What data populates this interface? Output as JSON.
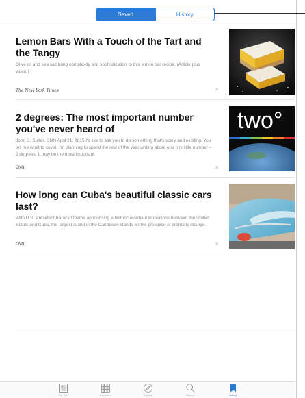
{
  "segments": {
    "saved": "Saved",
    "history": "History",
    "selected": "Saved"
  },
  "articles": [
    {
      "title": "Lemon Bars With a Touch of the Tart and the Tangy",
      "excerpt": "Olive oil and sea salt bring complexity and sophistication to this lemon bar recipe. (Article plus video.)",
      "source": "The New York Times",
      "age": "1h"
    },
    {
      "title": "2 degrees: The most important number you've never heard of",
      "excerpt": "John D. Sutter, CNN April 21, 2015 I'd like to ask you to do something that's scary and exciting. You tell me what to cover. I'm planning to spend the rest of the year writing about one tiny little number – 2 degrees. It may be the most important",
      "source": "CNN",
      "age": "1h",
      "thumb_text": "two°"
    },
    {
      "title": "How long can Cuba's beautiful classic cars last?",
      "excerpt": "With U.S. President Barack Obama announcing a historic overhaul in relations between the United States and Cuba, the largest island in the Caribbean stands on the precipice of dramatic change.",
      "source": "CNN",
      "age": "1h"
    }
  ],
  "tabbar": {
    "items": [
      {
        "label": "For You",
        "icon": "newspaper-icon"
      },
      {
        "label": "Favorites",
        "icon": "grid-icon"
      },
      {
        "label": "Explore",
        "icon": "compass-icon"
      },
      {
        "label": "Search",
        "icon": "search-icon"
      },
      {
        "label": "Saved",
        "icon": "bookmark-icon"
      }
    ],
    "active": "Saved"
  },
  "colors": {
    "accent": "#2c7bd6"
  }
}
